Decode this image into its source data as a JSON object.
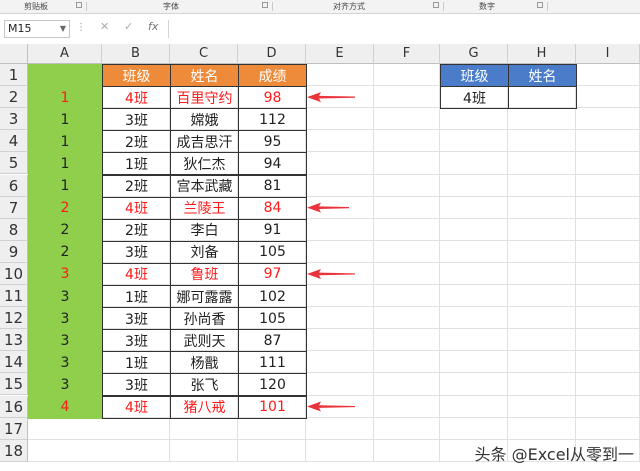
{
  "ribbon": {
    "groups": [
      "剪贴板",
      "字体",
      "对齐方式",
      "数字"
    ]
  },
  "formula_bar": {
    "name_box": "M15",
    "cancel_icon": "✕",
    "confirm_icon": "✓",
    "fx_label": "fx",
    "formula": ""
  },
  "columns": [
    "A",
    "B",
    "C",
    "D",
    "E",
    "F",
    "G",
    "H",
    "I"
  ],
  "rows": [
    "1",
    "2",
    "3",
    "4",
    "5",
    "6",
    "7",
    "8",
    "9",
    "10",
    "11",
    "12",
    "13",
    "14",
    "15",
    "16",
    "17",
    "18"
  ],
  "table": {
    "headers": [
      "班级",
      "姓名",
      "成绩"
    ],
    "header_color": "#ed8b3a",
    "rows": [
      {
        "a": "1",
        "b": "4班",
        "c": "百里守约",
        "d": "98",
        "highlight": true
      },
      {
        "a": "1",
        "b": "3班",
        "c": "嫦娥",
        "d": "112",
        "highlight": false
      },
      {
        "a": "1",
        "b": "2班",
        "c": "成吉思汗",
        "d": "95",
        "highlight": false
      },
      {
        "a": "1",
        "b": "1班",
        "c": "狄仁杰",
        "d": "94",
        "highlight": false
      },
      {
        "a": "1",
        "b": "2班",
        "c": "宫本武藏",
        "d": "81",
        "highlight": false
      },
      {
        "a": "2",
        "b": "4班",
        "c": "兰陵王",
        "d": "84",
        "highlight": true
      },
      {
        "a": "2",
        "b": "2班",
        "c": "李白",
        "d": "91",
        "highlight": false
      },
      {
        "a": "2",
        "b": "3班",
        "c": "刘备",
        "d": "105",
        "highlight": false
      },
      {
        "a": "3",
        "b": "4班",
        "c": "鲁班",
        "d": "97",
        "highlight": true
      },
      {
        "a": "3",
        "b": "1班",
        "c": "娜可露露",
        "d": "102",
        "highlight": false
      },
      {
        "a": "3",
        "b": "3班",
        "c": "孙尚香",
        "d": "105",
        "highlight": false
      },
      {
        "a": "3",
        "b": "3班",
        "c": "武则天",
        "d": "87",
        "highlight": false
      },
      {
        "a": "3",
        "b": "1班",
        "c": "杨戬",
        "d": "111",
        "highlight": false
      },
      {
        "a": "3",
        "b": "3班",
        "c": "张飞",
        "d": "120",
        "highlight": false
      },
      {
        "a": "4",
        "b": "4班",
        "c": "猪八戒",
        "d": "101",
        "highlight": true
      }
    ],
    "green_color": "#90cf4c",
    "highlight_text_color": "#ff1a1a"
  },
  "lookup": {
    "headers": [
      "班级",
      "姓名"
    ],
    "class_value": "4班",
    "name_value": "",
    "header_color": "#4a7cc9"
  },
  "arrows": {
    "color": "#e8343a"
  },
  "watermark": {
    "text": "头条 @Excel从零到一"
  }
}
